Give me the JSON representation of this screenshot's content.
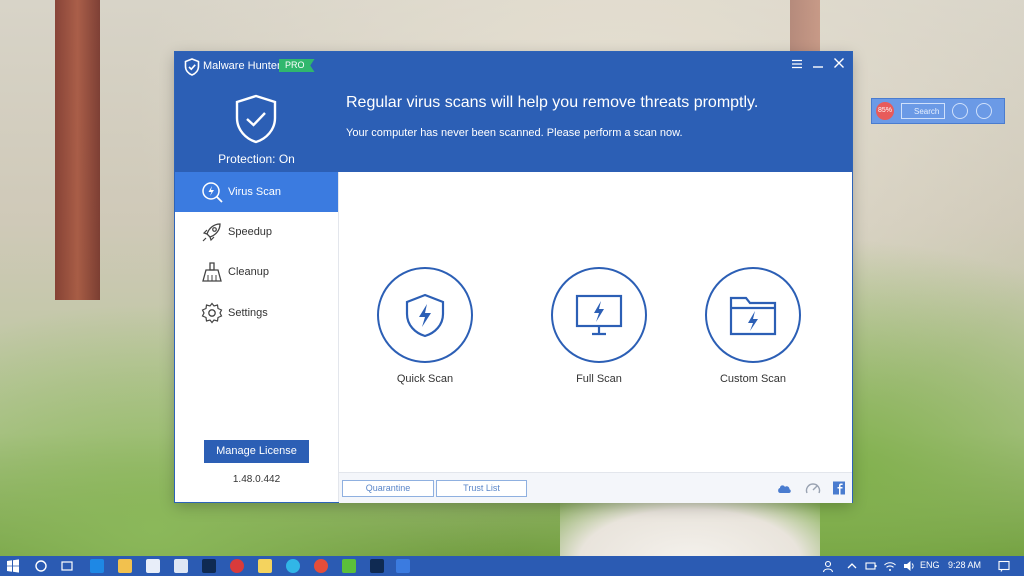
{
  "window": {
    "app_title": "Malware Hunter",
    "badge": "PRO",
    "protection_status": "Protection: On",
    "headline": "Regular virus scans will help you remove threats promptly.",
    "subline": "Your computer has never been scanned. Please perform a scan now."
  },
  "sidebar": {
    "items": [
      {
        "label": "Virus Scan",
        "icon": "virus-scan-icon",
        "active": true
      },
      {
        "label": "Speedup",
        "icon": "rocket-icon",
        "active": false
      },
      {
        "label": "Cleanup",
        "icon": "broom-icon",
        "active": false
      },
      {
        "label": "Settings",
        "icon": "gear-icon",
        "active": false
      }
    ],
    "license_button": "Manage License",
    "version": "1.48.0.442"
  },
  "scans": [
    {
      "label": "Quick Scan",
      "icon": "shield-bolt-icon"
    },
    {
      "label": "Full Scan",
      "icon": "monitor-bolt-icon"
    },
    {
      "label": "Custom Scan",
      "icon": "folder-bolt-icon"
    }
  ],
  "footer": {
    "quarantine": "Quarantine",
    "trust_list": "Trust List"
  },
  "widget": {
    "percent": "85%",
    "search": "Search"
  },
  "taskbar": {
    "language": "ENG",
    "time": "9:28 AM"
  },
  "colors": {
    "primary": "#2c5fb5",
    "active_nav": "#3b7be0",
    "badge_green": "#30b76d"
  }
}
